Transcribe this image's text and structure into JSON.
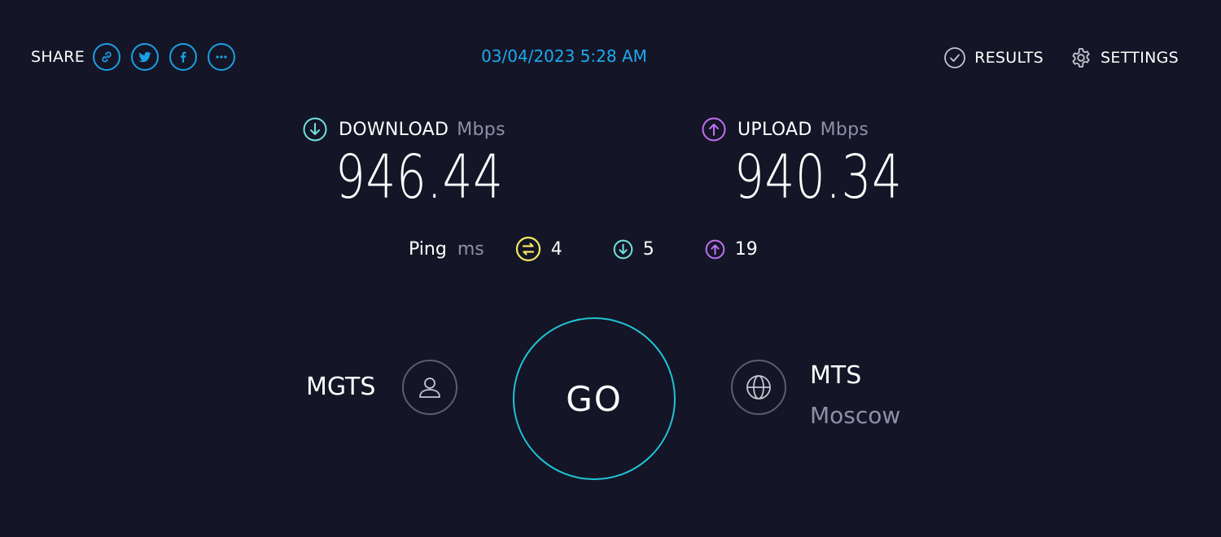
{
  "header": {
    "share_label": "SHARE",
    "share_buttons": [
      {
        "icon": "link-icon"
      },
      {
        "icon": "twitter-icon"
      },
      {
        "icon": "facebook-icon"
      },
      {
        "icon": "more-icon"
      }
    ],
    "datetime": "03/04/2023 5:28 AM",
    "results_label": "RESULTS",
    "settings_label": "SETTINGS"
  },
  "download": {
    "label": "DOWNLOAD",
    "unit": "Mbps",
    "value": "946.44"
  },
  "upload": {
    "label": "UPLOAD",
    "unit": "Mbps",
    "value": "940.34"
  },
  "ping": {
    "label": "Ping",
    "unit": "ms",
    "idle": "4",
    "download": "5",
    "upload": "19"
  },
  "isp": {
    "name": "MGTS"
  },
  "go_label": "GO",
  "server": {
    "name": "MTS",
    "location": "Moscow"
  },
  "colors": {
    "background": "#141526",
    "accent_blue": "#1ea9f0",
    "download": "#6fe3e0",
    "upload": "#bf71f2",
    "ping_idle": "#f3e866",
    "go_ring": "#20c3d6",
    "muted": "#8f90a6"
  }
}
